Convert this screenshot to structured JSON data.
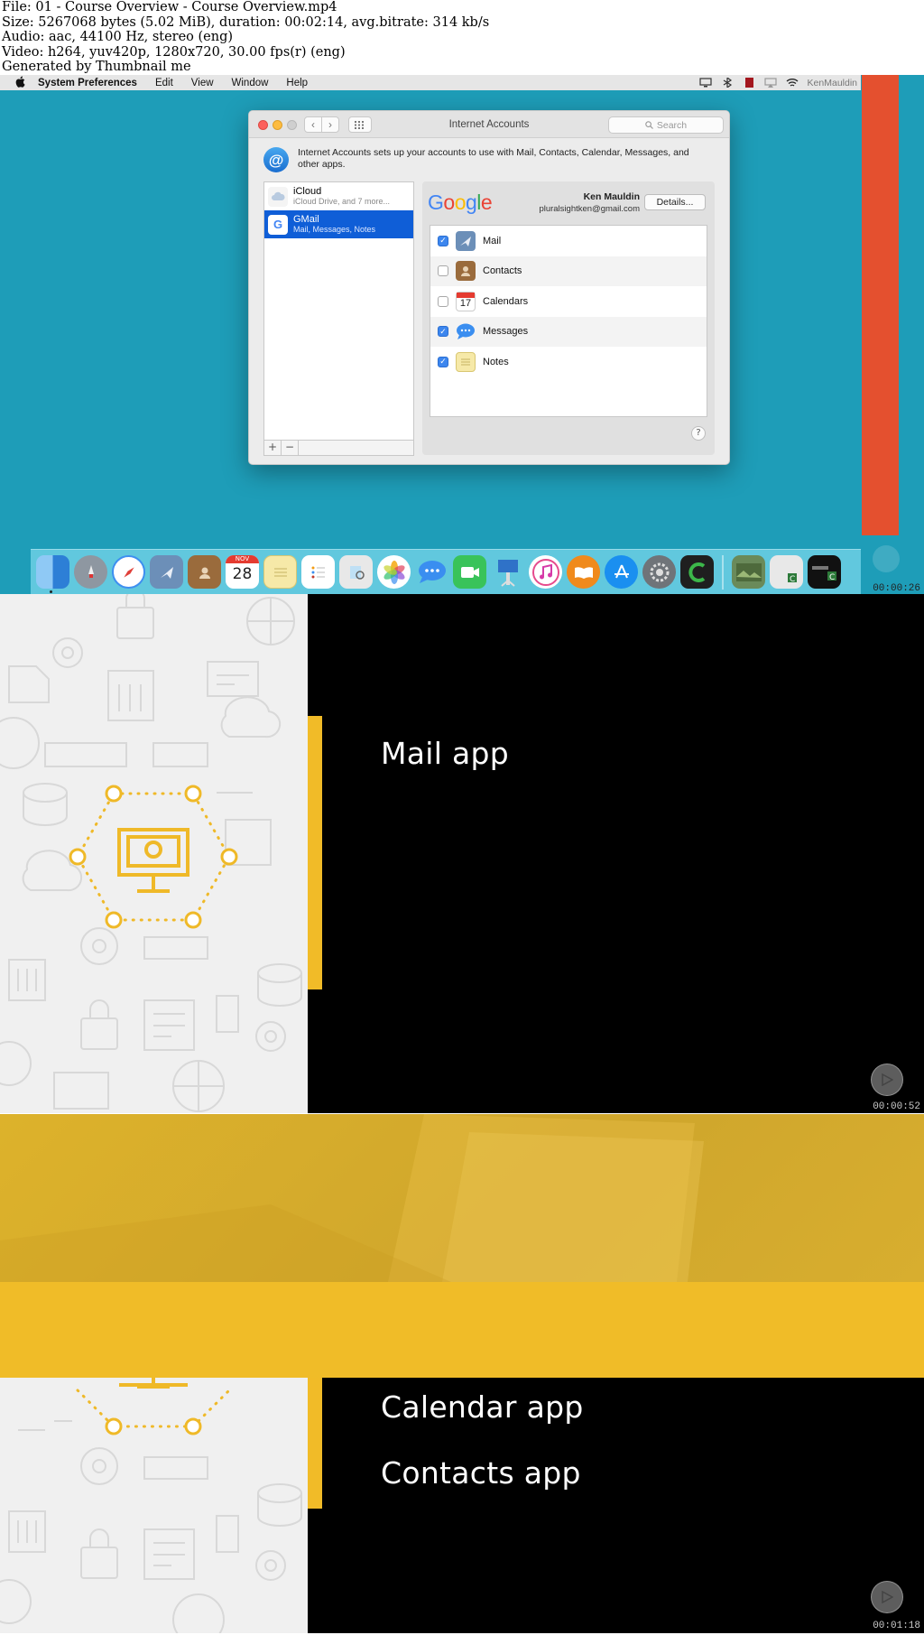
{
  "info": {
    "lines": [
      "File: 01 - Course Overview - Course Overview.mp4",
      "Size: 5267068 bytes (5.02 MiB), duration: 00:02:14, avg.bitrate: 314 kb/s",
      "Audio: aac, 44100 Hz, stereo (eng)",
      "Video: h264, yuv420p, 1280x720, 30.00 fps(r) (eng)",
      "Generated by Thumbnail me"
    ]
  },
  "frame1": {
    "menubar": {
      "apple": "",
      "app": "System Preferences",
      "items": [
        "Edit",
        "View",
        "Window",
        "Help"
      ],
      "user": "KenMauldin"
    },
    "window": {
      "title": "Internet Accounts",
      "search_placeholder": "Search",
      "back": "‹",
      "forward": "›",
      "intro_line1": "Internet Accounts sets up your accounts to use with Mail, Contacts, Calendar, Messages, and",
      "intro_line2": "other apps.",
      "accounts": [
        {
          "name": "iCloud",
          "subtitle": "iCloud Drive, and 7 more...",
          "selected": false
        },
        {
          "name": "GMail",
          "subtitle": "Mail, Messages, Notes",
          "selected": true
        }
      ],
      "add_button": "+",
      "remove_button": "−",
      "provider_logo": "Google",
      "account_name": "Ken Mauldin",
      "account_email": "pluralsightken@gmail.com",
      "details_button": "Details...",
      "services": [
        {
          "label": "Mail",
          "checked": true,
          "icon": "mail-icon"
        },
        {
          "label": "Contacts",
          "checked": false,
          "icon": "contacts-icon"
        },
        {
          "label": "Calendars",
          "checked": false,
          "icon": "calendar-icon"
        },
        {
          "label": "Messages",
          "checked": true,
          "icon": "messages-icon"
        },
        {
          "label": "Notes",
          "checked": true,
          "icon": "notes-icon"
        }
      ],
      "help": "?"
    },
    "dock": {
      "calendar_month": "NOV",
      "calendar_day": "28"
    },
    "timestamp": "00:00:26"
  },
  "frame2": {
    "title": "Mail app",
    "timestamp": "00:00:52"
  },
  "frame3": {
    "lines": [
      "Calendar app",
      "Contacts app"
    ],
    "timestamp": "00:01:18"
  },
  "colors": {
    "desktop": "#1e9db8",
    "accent_yellow": "#f1bb28",
    "highlight_blue": "#0f5ed7",
    "orange_strip": "#e4502f"
  }
}
